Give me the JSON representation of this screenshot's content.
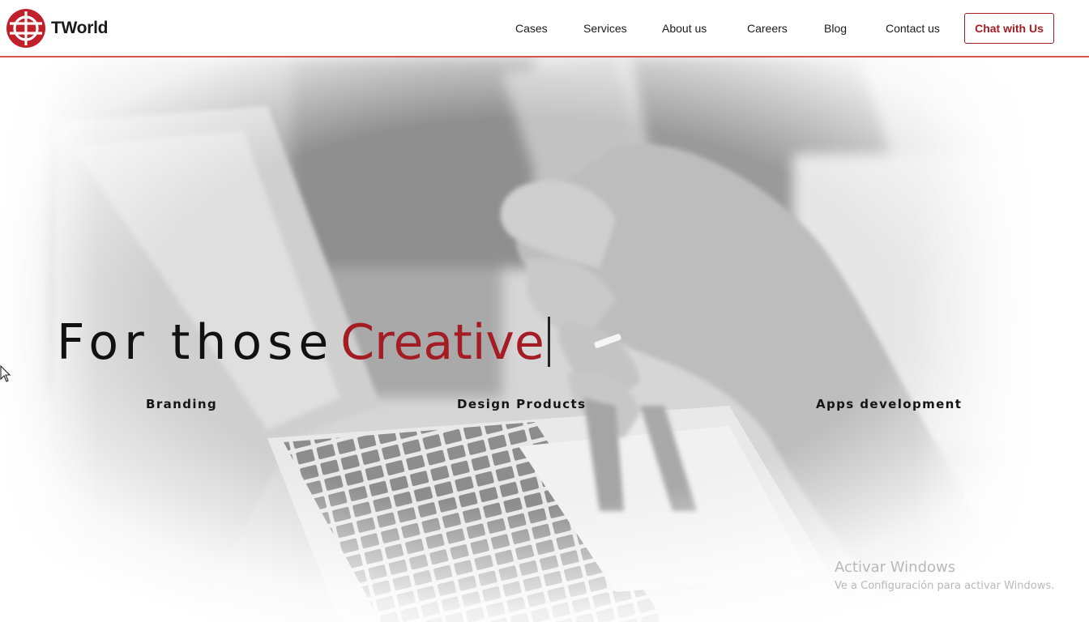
{
  "header": {
    "brand": "TWorld",
    "logo_icon": "globe-logo-icon",
    "nav": [
      {
        "label": "Cases"
      },
      {
        "label": "Services"
      },
      {
        "label": "About us"
      },
      {
        "label": "Careers"
      },
      {
        "label": "Blog"
      },
      {
        "label": "Contact us"
      }
    ],
    "cta_label": "Chat with Us"
  },
  "hero": {
    "headline_static": "For those",
    "headline_typed": "Creative",
    "services": [
      "Branding",
      "Design Products",
      "Apps development"
    ]
  },
  "watermark": {
    "title": "Activar Windows",
    "subtitle": "Ve a Configuración para activar Windows."
  },
  "colors": {
    "accent": "#a41d24",
    "header_border": "#d9534f",
    "text": "#111111"
  }
}
